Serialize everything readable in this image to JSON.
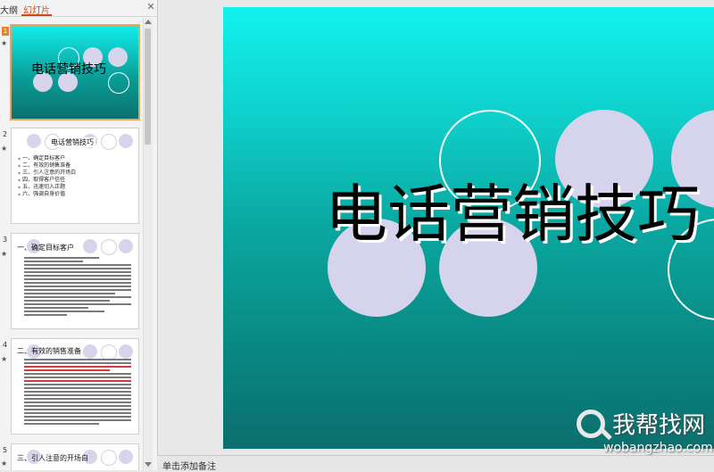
{
  "panel": {
    "tabs": {
      "outline": "大纲",
      "slides": "幻灯片"
    },
    "close_glyph": "✕"
  },
  "thumbnails": [
    {
      "number": "1",
      "star": "★",
      "title": "电话营销技巧"
    },
    {
      "number": "2",
      "star": "★",
      "title": "电话营销技巧",
      "items": [
        "一、确定目标客户",
        "二、有效的销售准备",
        "三、引人注意的开场白",
        "四、取得客户信任",
        "五、迅速切入正题",
        "六、强调自身价值"
      ]
    },
    {
      "number": "3",
      "star": "★",
      "title": "一、确定目标客户"
    },
    {
      "number": "4",
      "star": "★",
      "title": "二、有效的销售准备"
    },
    {
      "number": "5",
      "star": "★",
      "title": "三、引人注意的开场白"
    }
  ],
  "slide": {
    "title": "电话营销技巧"
  },
  "watermark": {
    "brand": "我帮找网",
    "url": "wobangzhao.com"
  },
  "notes": {
    "placeholder": "单击添加备注"
  },
  "colors": {
    "accent": "#d04a1c",
    "selection": "#f0a45a",
    "circle_fill": "#d6d4ec",
    "slide_top": "#12f2ef",
    "slide_bottom": "#0b6f6d"
  }
}
